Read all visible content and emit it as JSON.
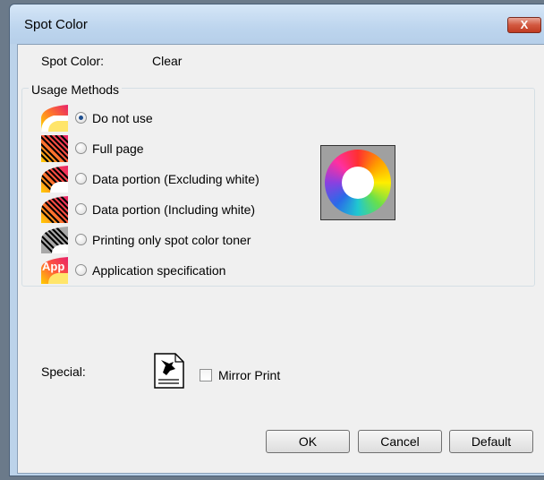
{
  "window": {
    "title": "Spot Color",
    "close_label": "X"
  },
  "spot_color": {
    "label": "Spot Color:",
    "value": "Clear"
  },
  "usage_methods": {
    "title": "Usage Methods",
    "options": [
      {
        "label": "Do not use",
        "selected": true,
        "icon": "spot-color-none-icon"
      },
      {
        "label": "Full page",
        "selected": false,
        "icon": "full-page-icon"
      },
      {
        "label": "Data portion (Excluding white)",
        "selected": false,
        "icon": "data-excluding-white-icon"
      },
      {
        "label": "Data portion (Including white)",
        "selected": false,
        "icon": "data-including-white-icon"
      },
      {
        "label": "Printing only spot color toner",
        "selected": false,
        "icon": "spot-toner-only-icon"
      },
      {
        "label": "Application specification",
        "selected": false,
        "icon": "application-spec-icon",
        "icon_text": "App"
      }
    ]
  },
  "special": {
    "label": "Special:",
    "mirror_print_label": "Mirror Print",
    "mirror_print_checked": false
  },
  "buttons": {
    "ok": "OK",
    "cancel": "Cancel",
    "default": "Default"
  },
  "colors": {
    "title_bar": "#bcd3ea",
    "close_button": "#c9452c",
    "radio_dot": "#1e4e8f"
  }
}
